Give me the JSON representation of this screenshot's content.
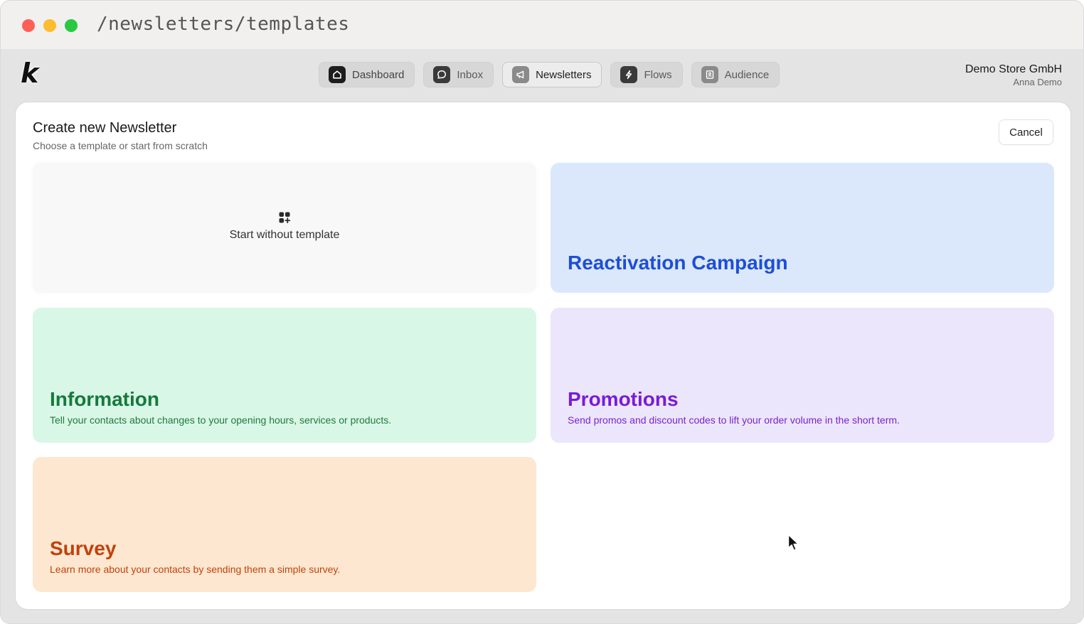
{
  "browser": {
    "url": "/newsletters/templates"
  },
  "app": {
    "logo": "k"
  },
  "nav": {
    "items": [
      {
        "label": "Dashboard",
        "icon": "home-icon"
      },
      {
        "label": "Inbox",
        "icon": "chat-bubble-icon"
      },
      {
        "label": "Newsletters",
        "icon": "megaphone-icon",
        "active": true
      },
      {
        "label": "Flows",
        "icon": "lightning-icon"
      },
      {
        "label": "Audience",
        "icon": "contact-book-icon"
      }
    ]
  },
  "account": {
    "store": "Demo Store GmbH",
    "user": "Anna Demo"
  },
  "panel": {
    "title": "Create new Newsletter",
    "subtitle": "Choose a template or start from scratch",
    "cancel_label": "Cancel"
  },
  "templates": {
    "blank": {
      "label": "Start without template",
      "icon": "grid-plus-icon"
    },
    "reactivation": {
      "title": "Reactivation Campaign",
      "color": "#1d4ed8",
      "background": "#dbe8fc"
    },
    "information": {
      "title": "Information",
      "description": "Tell your contacts about changes to your opening hours, services or products.",
      "color": "#157a3a",
      "background": "#d9f7e6"
    },
    "promotions": {
      "title": "Promotions",
      "description": "Send promos and discount codes to lift your order volume in the short term.",
      "color": "#7a1bd8",
      "background": "#ebe6fb"
    },
    "survey": {
      "title": "Survey",
      "description": "Learn more about your contacts by sending them a simple survey.",
      "color": "#c2410c",
      "background": "#fde7d0"
    }
  }
}
